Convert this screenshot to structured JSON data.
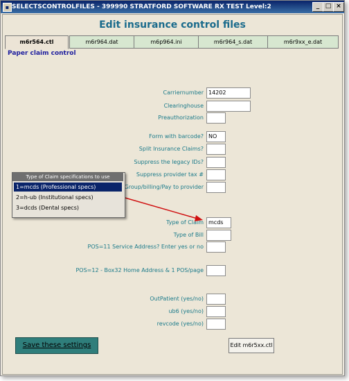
{
  "window": {
    "title": "SELECTSCONTROLFILES - 399990 STRATFORD SOFTWARE RX TEST Level:2"
  },
  "heading": "Edit insurance control files",
  "tabs": [
    "m6r564.ctl",
    "m6r964.dat",
    "m6p964.ini",
    "m6r964_s.dat",
    "m6r9xx_e.dat"
  ],
  "subtitle": "Paper claim control",
  "fields": {
    "carriernumber": {
      "label": "Carriernumber",
      "value": "14202"
    },
    "clearinghouse": {
      "label": "Clearinghouse",
      "value": ""
    },
    "preauthorization": {
      "label": "Preauthorization",
      "value": ""
    },
    "form_barcode": {
      "label": "Form with barcode?",
      "value": "NO"
    },
    "split_claims": {
      "label": "Split Insurance Claims?",
      "value": ""
    },
    "suppress_legacy": {
      "label": "Suppress the legacy IDs?",
      "value": ""
    },
    "suppress_tax": {
      "label": "Suppress provider tax #",
      "value": ""
    },
    "group_billing": {
      "label": "Group/billing/Pay to provider",
      "value": ""
    },
    "type_of_claim": {
      "label": "Type of Claim",
      "value": "mcds"
    },
    "type_of_bill": {
      "label": "Type of Bill",
      "value": ""
    },
    "pos11": {
      "label": "POS=11 Service Address? Enter yes or no",
      "value": ""
    },
    "pos12": {
      "label": "POS=12 - Box32 Home Address & 1 POS/page",
      "value": ""
    },
    "outpatient": {
      "label": "OutPatient  (yes/no)",
      "value": ""
    },
    "ub6": {
      "label": "ub6 (yes/no)",
      "value": ""
    },
    "revcode": {
      "label": "revcode  (yes/no)",
      "value": ""
    }
  },
  "popup": {
    "header": "Type of Claim specifications to use",
    "options": [
      "1=mcds (Professional specs)",
      "2=h-ub (Institutional specs)",
      "3=dcds (Dental specs)"
    ],
    "selected_index": 0
  },
  "buttons": {
    "save": "Save these settings",
    "edit": "Edit m6r5xx.ctl"
  },
  "colors": {
    "title_bar": "#0a246a",
    "heading": "#1a6b8c",
    "label": "#1a7a8a",
    "save_button": "#2f7e7b",
    "arrow": "#d01010"
  }
}
